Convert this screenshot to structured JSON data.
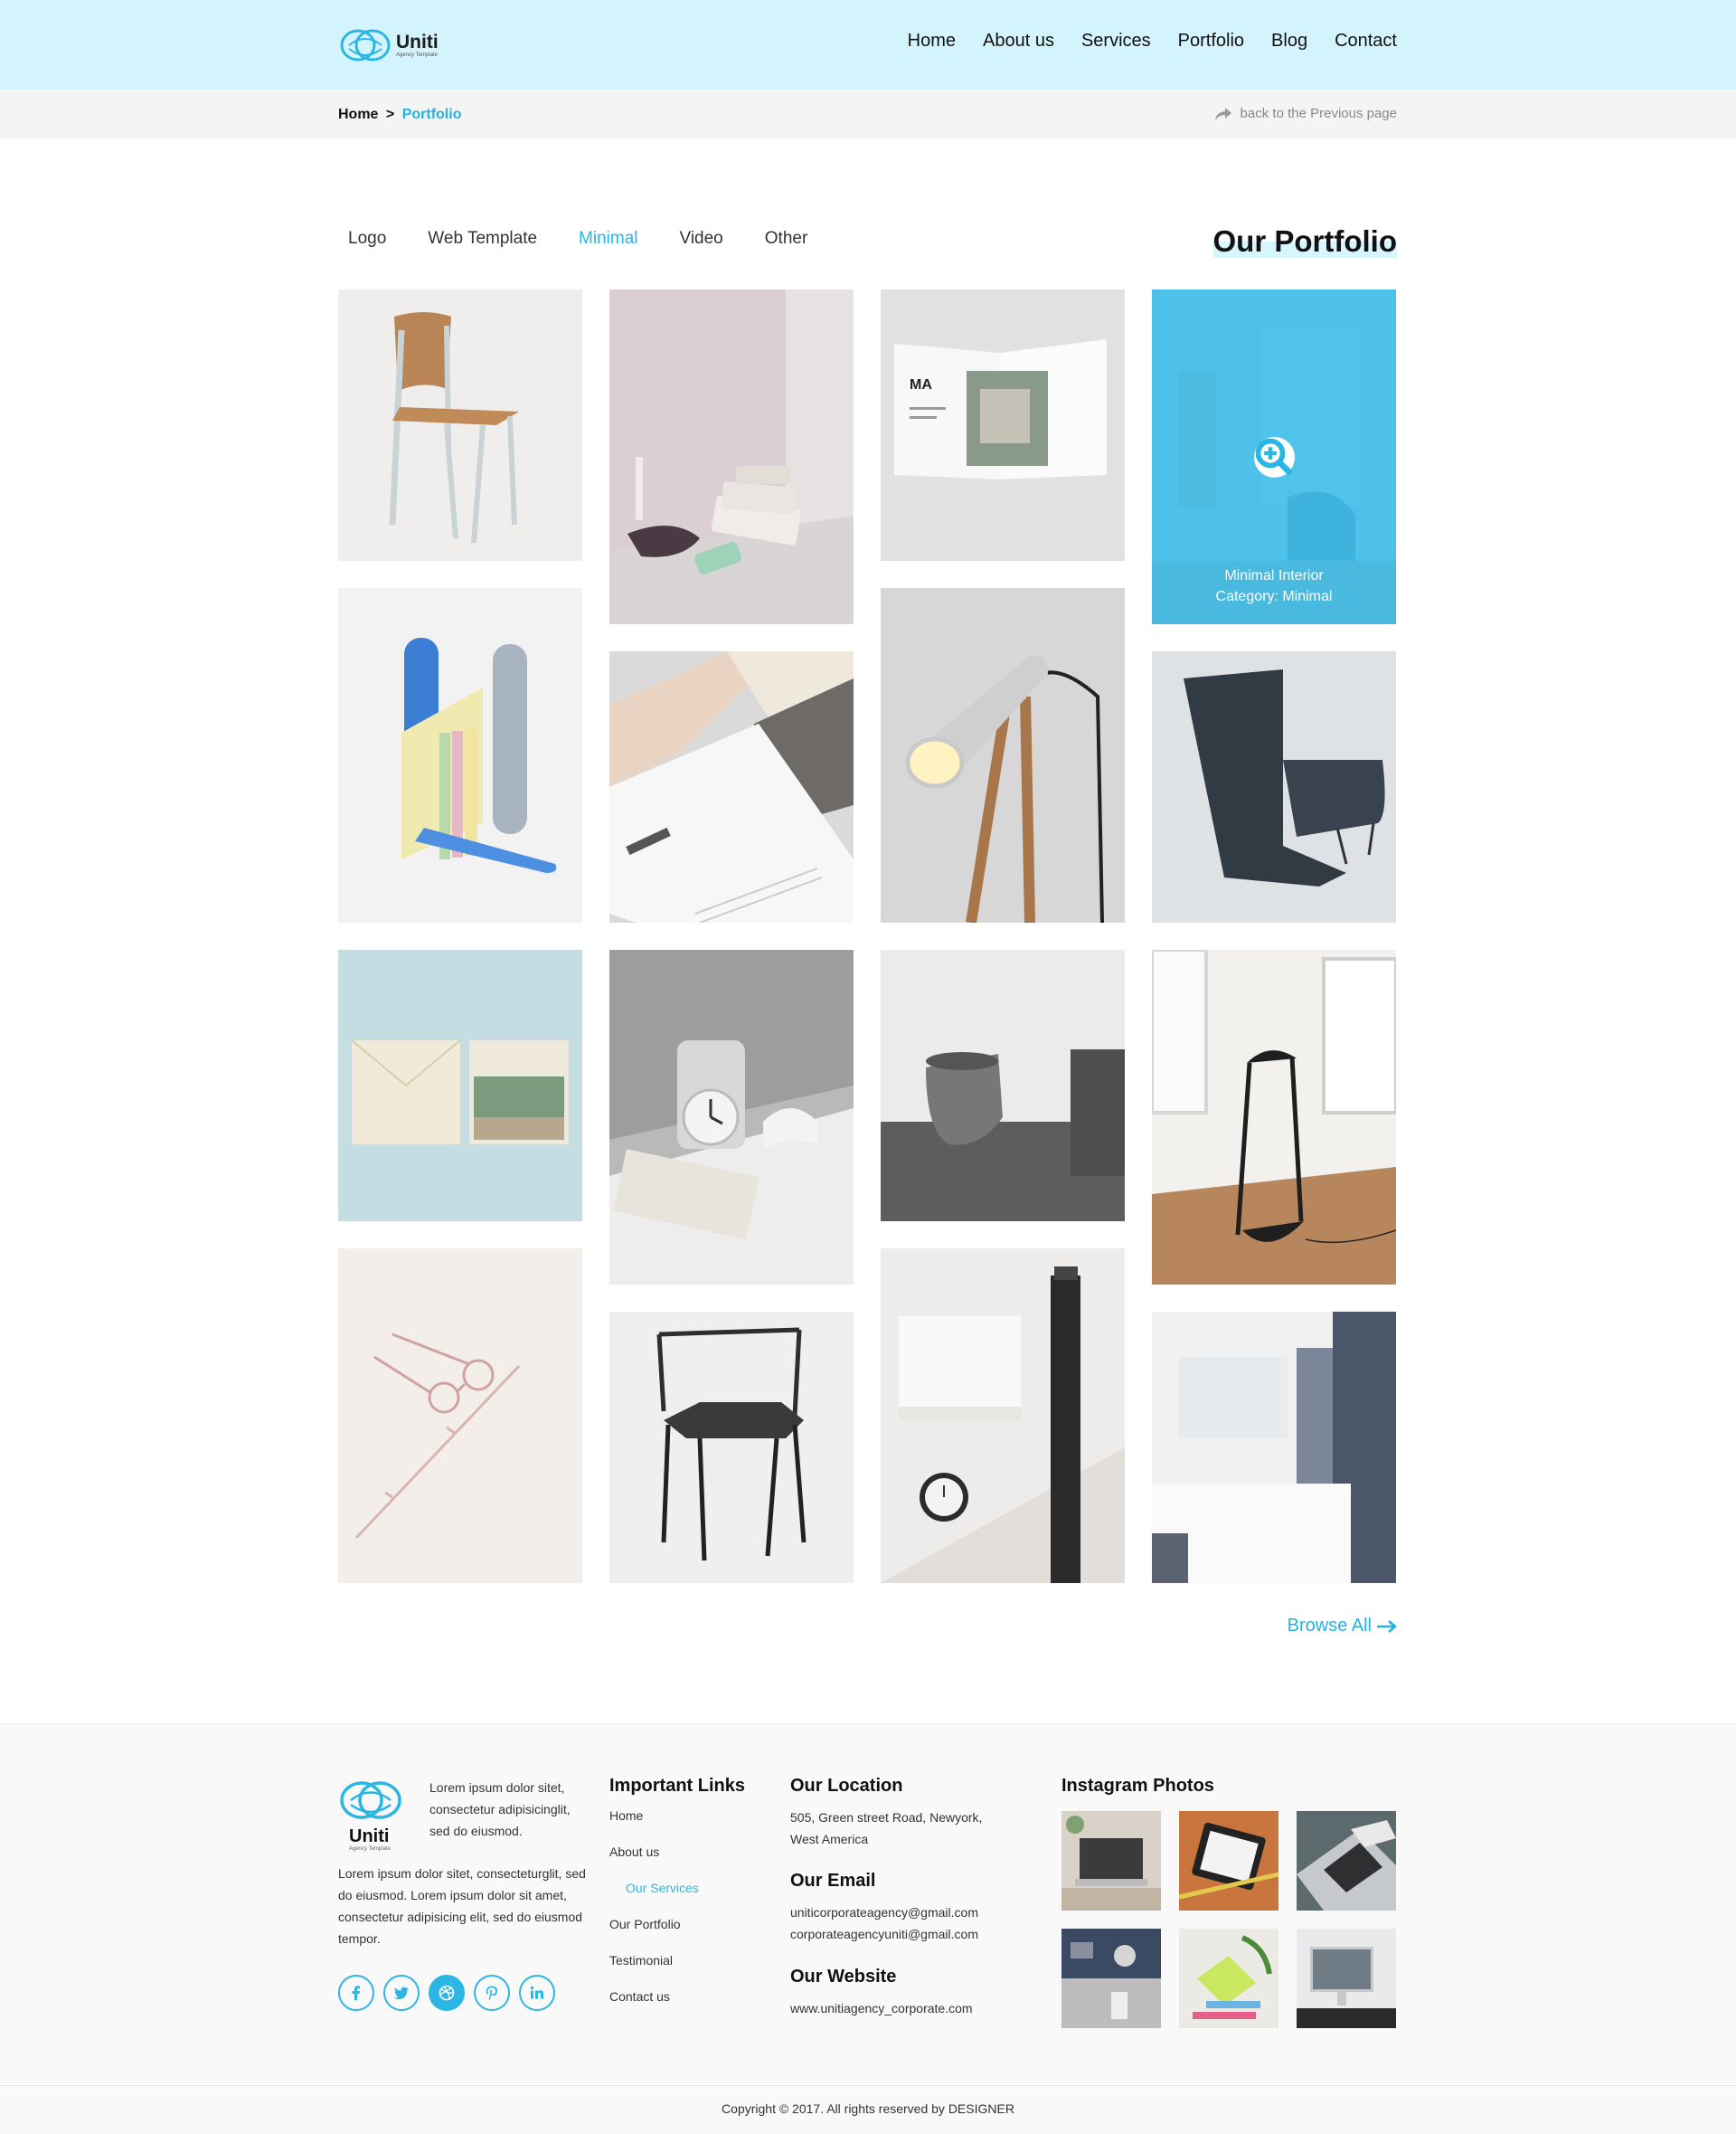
{
  "header": {
    "logo_name": "Uniti",
    "logo_tagline": "Agency Template",
    "nav": [
      "Home",
      "About us",
      "Services",
      "Portfolio",
      "Blog",
      "Contact"
    ]
  },
  "breadcrumb": {
    "home": "Home",
    "separator": ">",
    "current": "Portfolio",
    "back": "back to the Previous page"
  },
  "portfolio": {
    "filters": [
      "Logo",
      "Web Template",
      "Minimal",
      "Video",
      "Other"
    ],
    "active_filter": "Minimal",
    "title": "Our Portfolio",
    "hover_title": "Minimal Interior",
    "hover_category": "Category: Minimal",
    "browse_all": "Browse All",
    "tiles": [
      "wood-chair-icon",
      "candle-books-icon",
      "magazine-icon",
      "interior-room-icon",
      "colorful-bookend-icon",
      "stationery-icon",
      "desk-lamp-icon",
      "dark-armchair-icon",
      "envelope-cards-icon",
      "clock-icon",
      "grey-cup-icon",
      "floor-lamp-icon",
      "glasses-icon",
      "black-chair-icon",
      "wristwatch-icon",
      "bathroom-icon"
    ]
  },
  "footer": {
    "logo_name": "Uniti",
    "logo_tagline": "Agency Template",
    "intro": "Lorem ipsum dolor sitet, consectetur adipisicinglit, sed do eiusmod.",
    "about": "Lorem ipsum dolor sitet, consecteturglit, sed do eiusmod. Lorem ipsum dolor sit amet, consectetur adipisicing elit, sed do eiusmod tempor.",
    "social": [
      "facebook-icon",
      "twitter-icon",
      "dribbble-icon",
      "pinterest-icon",
      "linkedin-icon"
    ],
    "links_title": "Important Links",
    "links": [
      "Home",
      "About us",
      "Our Services",
      "Our Portfolio",
      "Testimonial",
      "Contact us"
    ],
    "location_title": "Our Location",
    "location": "505, Green street Road, Newyork, West America",
    "email_title": "Our Email",
    "email_1": "uniticorporateagency@gmail.com",
    "email_2": "corporateagencyuniti@gmail.com",
    "website_title": "Our Website",
    "website": "www.unitiagency_corporate.com",
    "instagram_title": "Instagram Photos",
    "copyright": "Copyright © 2017. All rights reserved by DESIGNER"
  },
  "colors": {
    "accent": "#29b6e3",
    "header_bg": "#d4f4fd",
    "breadcrumb_bg": "#f4f4f4",
    "overlay": "#3ebeeb"
  }
}
